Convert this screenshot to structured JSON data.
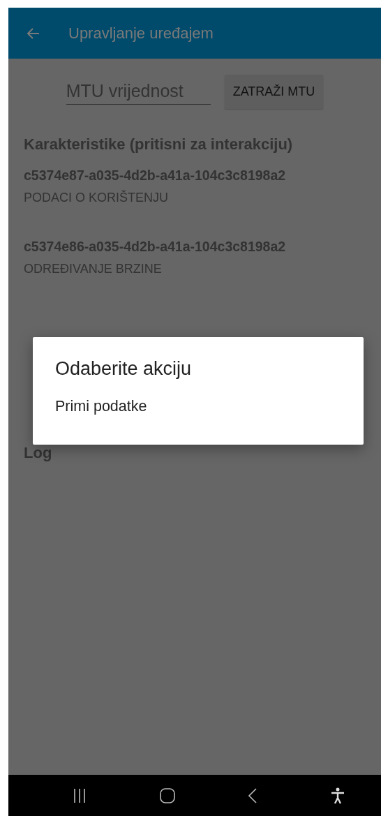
{
  "app_bar": {
    "title": "Upravljanje uređajem"
  },
  "mtu": {
    "placeholder": "MTU vrijednost",
    "button": "ZATRAŽI MTU"
  },
  "characteristics": {
    "heading": "Karakteristike (pritisni za interakciju)",
    "items": [
      {
        "uuid": "c5374e87-a035-4d2b-a41a-104c3c8198a2",
        "name": "PODACI O KORIŠTENJU"
      },
      {
        "uuid": "c5374e86-a035-4d2b-a41a-104c3c8198a2",
        "name": "ODREĐIVANJE BRZINE"
      }
    ]
  },
  "log": {
    "heading": "Log"
  },
  "dialog": {
    "title": "Odaberite akciju",
    "options": [
      "Primi podatke"
    ]
  }
}
